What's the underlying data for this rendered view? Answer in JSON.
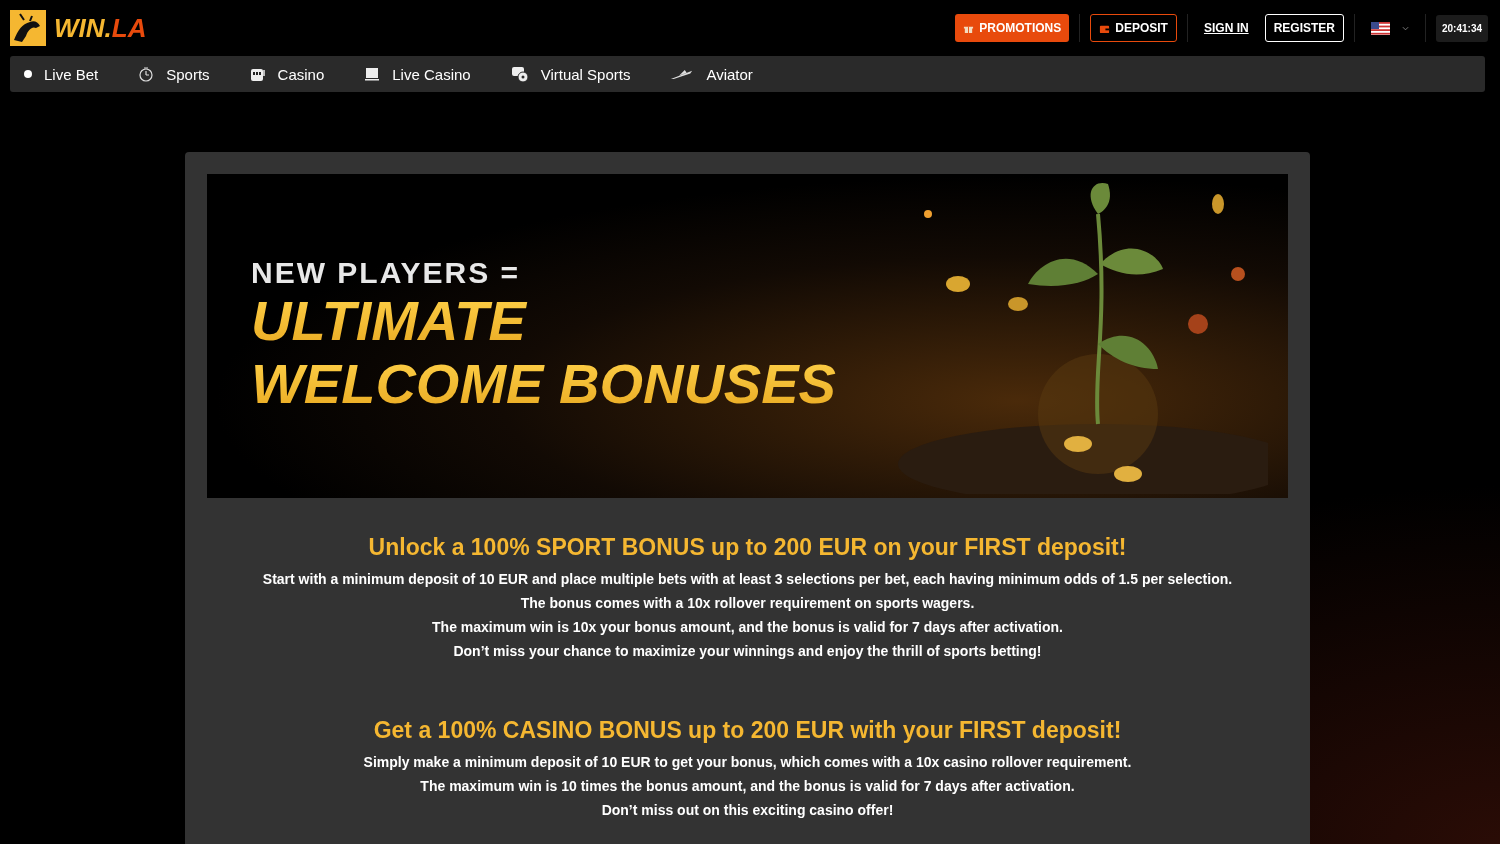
{
  "header": {
    "logo": {
      "part_1": "WIN.",
      "part_2": "LA"
    },
    "actions": [
      {
        "kind": "promo",
        "label": "PROMOTIONS"
      },
      {
        "kind": "deposit",
        "label": "DEPOSIT"
      },
      {
        "kind": "link",
        "label": "SIGN IN"
      },
      {
        "kind": "outline",
        "label": "REGISTER"
      }
    ],
    "clock": "20:41:34"
  },
  "nav": [
    {
      "label": "Live Bet"
    },
    {
      "label": "Sports"
    },
    {
      "label": "Casino"
    },
    {
      "label": "Live Casino"
    },
    {
      "label": "Virtual Sports"
    },
    {
      "label": "Aviator"
    }
  ],
  "banner": {
    "kicker": "NEW PLAYERS =",
    "headline_1": "ULTIMATE",
    "headline_2": "WELCOME BONUSES"
  },
  "sections": [
    {
      "title": "Unlock a 100% SPORT BONUS up to 200 EUR on your FIRST deposit!",
      "lines": [
        "Start with a minimum deposit of 10 EUR and place multiple bets with at least 3 selections per bet, each having minimum odds of 1.5 per selection.",
        "The bonus comes with a 10x rollover requirement on sports wagers.",
        "The maximum win is 10x your bonus amount, and the bonus is valid for 7 days after activation.",
        "Don’t miss your chance to maximize your winnings and enjoy the thrill of sports betting!"
      ]
    },
    {
      "title": "Get a 100% CASINO BONUS up to 200 EUR with your FIRST deposit!",
      "lines": [
        "Simply make a minimum deposit of 10 EUR to get your bonus, which comes with a 10x casino rollover requirement.",
        "The maximum win is 10 times the bonus amount, and the bonus is valid for 7 days after activation.",
        "Don’t miss out on this exciting casino offer!"
      ]
    }
  ]
}
